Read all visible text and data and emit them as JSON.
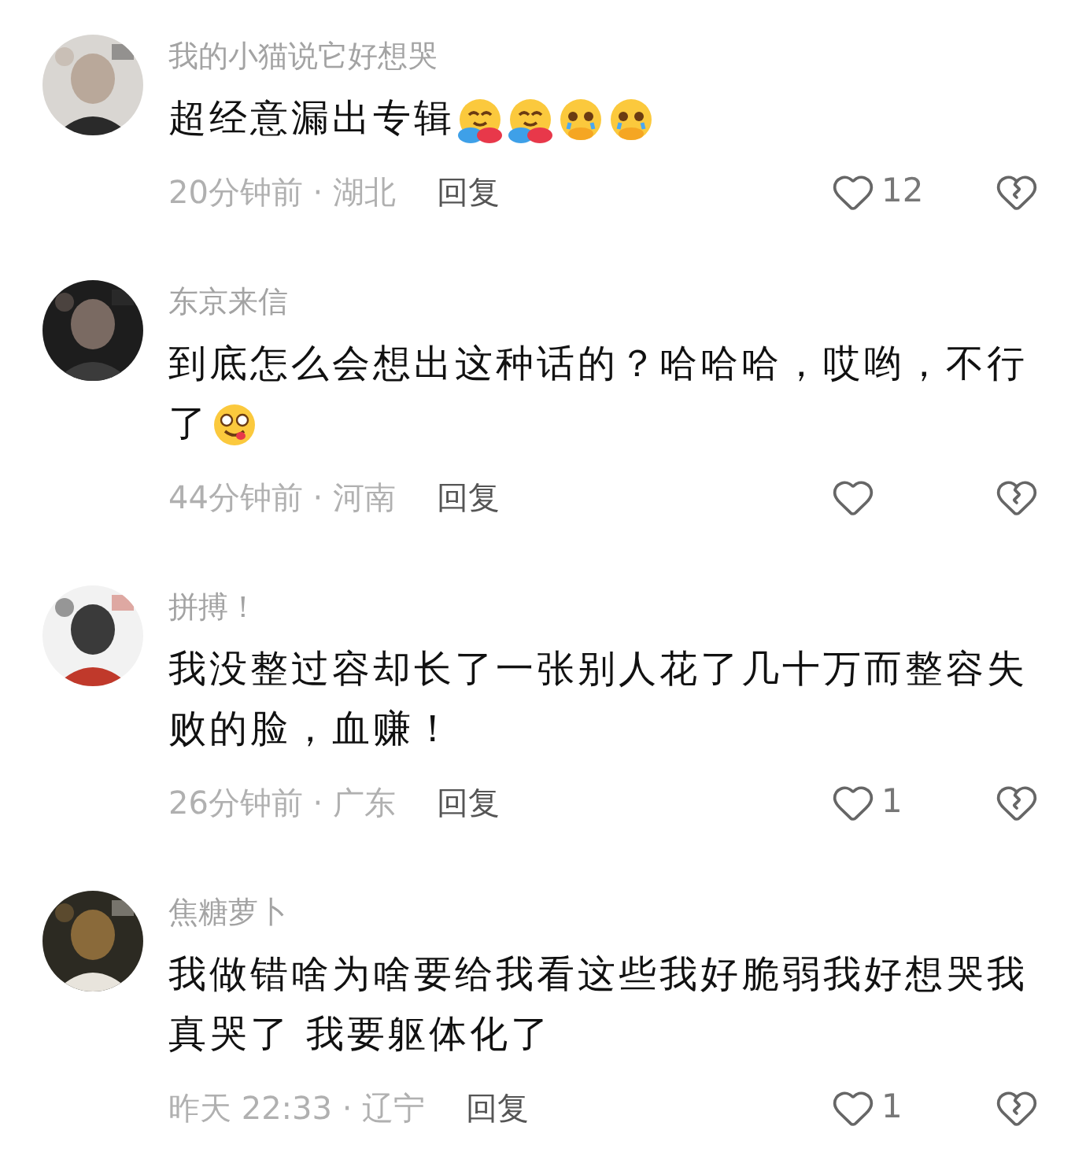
{
  "comments": [
    {
      "user": "我的小猫说它好想哭",
      "text": "超经意漏出专辑",
      "emojis": [
        {
          "kind": "hug"
        },
        {
          "kind": "hug"
        },
        {
          "kind": "teary"
        },
        {
          "kind": "teary"
        }
      ],
      "time": "20分钟前 · 湖北",
      "reply": "回复",
      "likes": "12"
    },
    {
      "user": "东京来信",
      "text": "到底怎么会想出这种话的？哈哈哈，哎哟，不行了",
      "emojis": [
        {
          "kind": "yum"
        }
      ],
      "time": "44分钟前 · 河南",
      "reply": "回复"
    },
    {
      "user": "拼搏！",
      "text": "我没整过容却长了一张别人花了几十万而整容失败的脸，血赚！",
      "time": "26分钟前 · 广东",
      "reply": "回复",
      "likes": "1"
    },
    {
      "user": "焦糖萝卜",
      "text": "我做错啥为啥要给我看这些我好脆弱我好想哭我真哭了 我要躯体化了",
      "time": "昨天 22:33 · 辽宁",
      "reply": "回复",
      "likes": "1"
    }
  ]
}
